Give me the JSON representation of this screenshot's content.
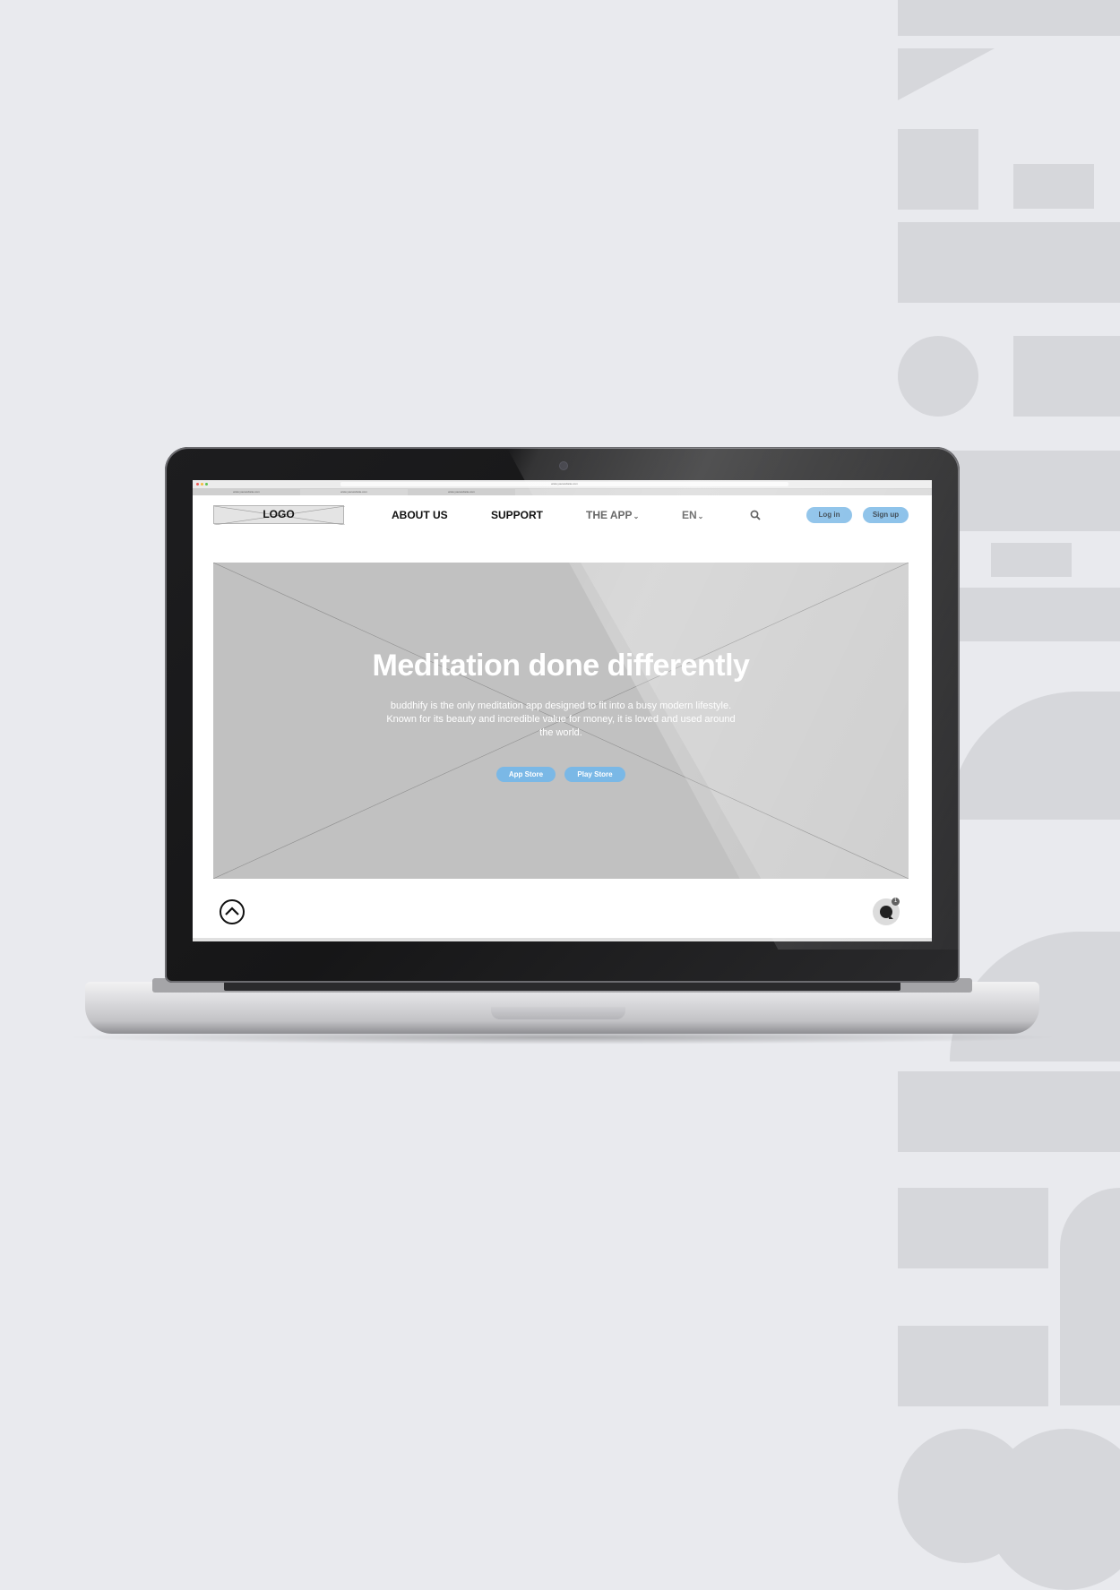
{
  "browser": {
    "url": "www.yourwebsite.com",
    "tabs": [
      "www.yourwebsite.com",
      "www.yourwebsite.com",
      "www.yourwebsite.com"
    ]
  },
  "nav": {
    "logo": "LOGO",
    "links": [
      "ABOUT US",
      "SUPPORT",
      "THE APP",
      "EN"
    ],
    "login": "Log in",
    "signup": "Sign up"
  },
  "hero": {
    "title": "Meditation done differently",
    "subtitle": "buddhify is the only meditation app designed to fit into a busy modern lifestyle. Known for its beauty and incredible value for money, it is loved and used around the world.",
    "app_store": "App Store",
    "play_store": "Play Store"
  },
  "chat": {
    "badge": "1"
  },
  "icons": {
    "search": "search-icon",
    "scroll_up": "chevron-up-icon",
    "chat": "chat-icon",
    "dropdown": "chevron-down-icon"
  },
  "colors": {
    "background": "#e9eaee",
    "accent": "#7ab8e6",
    "hero_placeholder": "#c1c1c1",
    "decor": "#d6d7db"
  }
}
